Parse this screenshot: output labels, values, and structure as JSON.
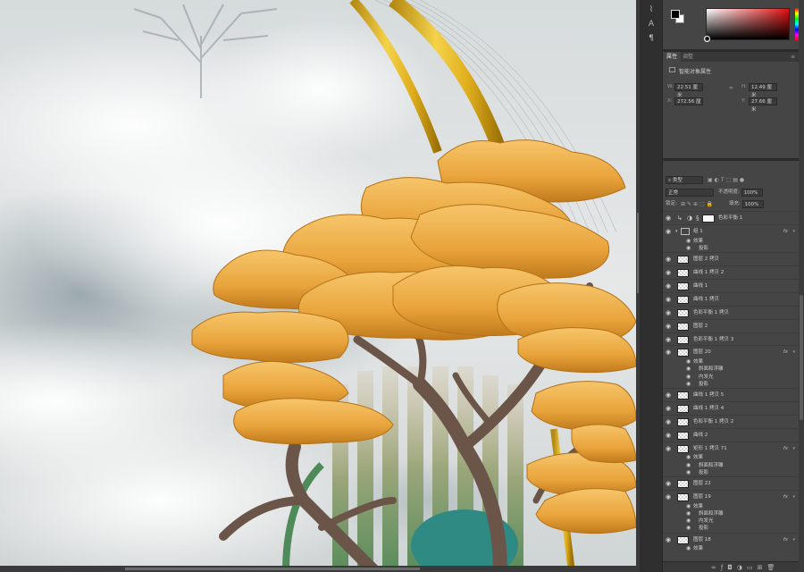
{
  "properties": {
    "tabs": [
      "属性",
      "调整"
    ],
    "title": "智能对象属性",
    "fields": {
      "w": {
        "label": "W:",
        "value": "22.51 厘米"
      },
      "h": {
        "label": "H:",
        "value": "12.49 厘米"
      },
      "x": {
        "label": "X:",
        "value": "272.56 厘"
      },
      "y": {
        "label": "Y:",
        "value": "27.66 厘米"
      }
    }
  },
  "layers": {
    "tabs": [
      "图层",
      "通道",
      "路径"
    ],
    "filter": "类型",
    "blend_mode": "正常",
    "opacity_label": "不透明度:",
    "opacity": "100%",
    "lock_label": "锁定:",
    "fill_label": "填充:",
    "fill": "100%",
    "rows": [
      {
        "kind": "adjust",
        "name": "色彩平衡 1",
        "mask": true
      },
      {
        "kind": "group",
        "name": "组 1",
        "fx": true
      },
      {
        "kind": "effect",
        "name": "效果"
      },
      {
        "kind": "subeffect",
        "name": "投影"
      },
      {
        "kind": "layer",
        "name": "图层 2 拷贝"
      },
      {
        "kind": "layer",
        "name": "曲线 1 拷贝 2"
      },
      {
        "kind": "layer",
        "name": "曲线 1"
      },
      {
        "kind": "layer",
        "name": "曲线 1 拷贝"
      },
      {
        "kind": "layer",
        "name": "色彩平衡 1 拷贝"
      },
      {
        "kind": "layer",
        "name": "图层 2"
      },
      {
        "kind": "layer",
        "name": "色彩平衡 1 拷贝 3"
      },
      {
        "kind": "layer",
        "name": "图层 20",
        "fx": true
      },
      {
        "kind": "effect",
        "name": "效果"
      },
      {
        "kind": "subeffect",
        "name": "斜面和浮雕"
      },
      {
        "kind": "subeffect",
        "name": "内发光"
      },
      {
        "kind": "subeffect",
        "name": "投影"
      },
      {
        "kind": "layer",
        "name": "曲线 1 拷贝 5"
      },
      {
        "kind": "layer",
        "name": "曲线 1 拷贝 4"
      },
      {
        "kind": "layer",
        "name": "色彩平衡 1 拷贝 2"
      },
      {
        "kind": "layer",
        "name": "曲线 2"
      },
      {
        "kind": "layer",
        "name": "矩形 1 拷贝 71",
        "fx": true
      },
      {
        "kind": "effect",
        "name": "效果"
      },
      {
        "kind": "subeffect",
        "name": "斜面和浮雕"
      },
      {
        "kind": "subeffect",
        "name": "投影"
      },
      {
        "kind": "layer",
        "name": "图层 22"
      },
      {
        "kind": "layer",
        "name": "图层 19",
        "fx": true
      },
      {
        "kind": "effect",
        "name": "效果"
      },
      {
        "kind": "subeffect",
        "name": "斜面和浮雕"
      },
      {
        "kind": "subeffect",
        "name": "内发光"
      },
      {
        "kind": "subeffect",
        "name": "投影"
      },
      {
        "kind": "layer",
        "name": "图层 18",
        "fx": true
      },
      {
        "kind": "effect",
        "name": "效果"
      }
    ],
    "fx_label": "fx"
  }
}
